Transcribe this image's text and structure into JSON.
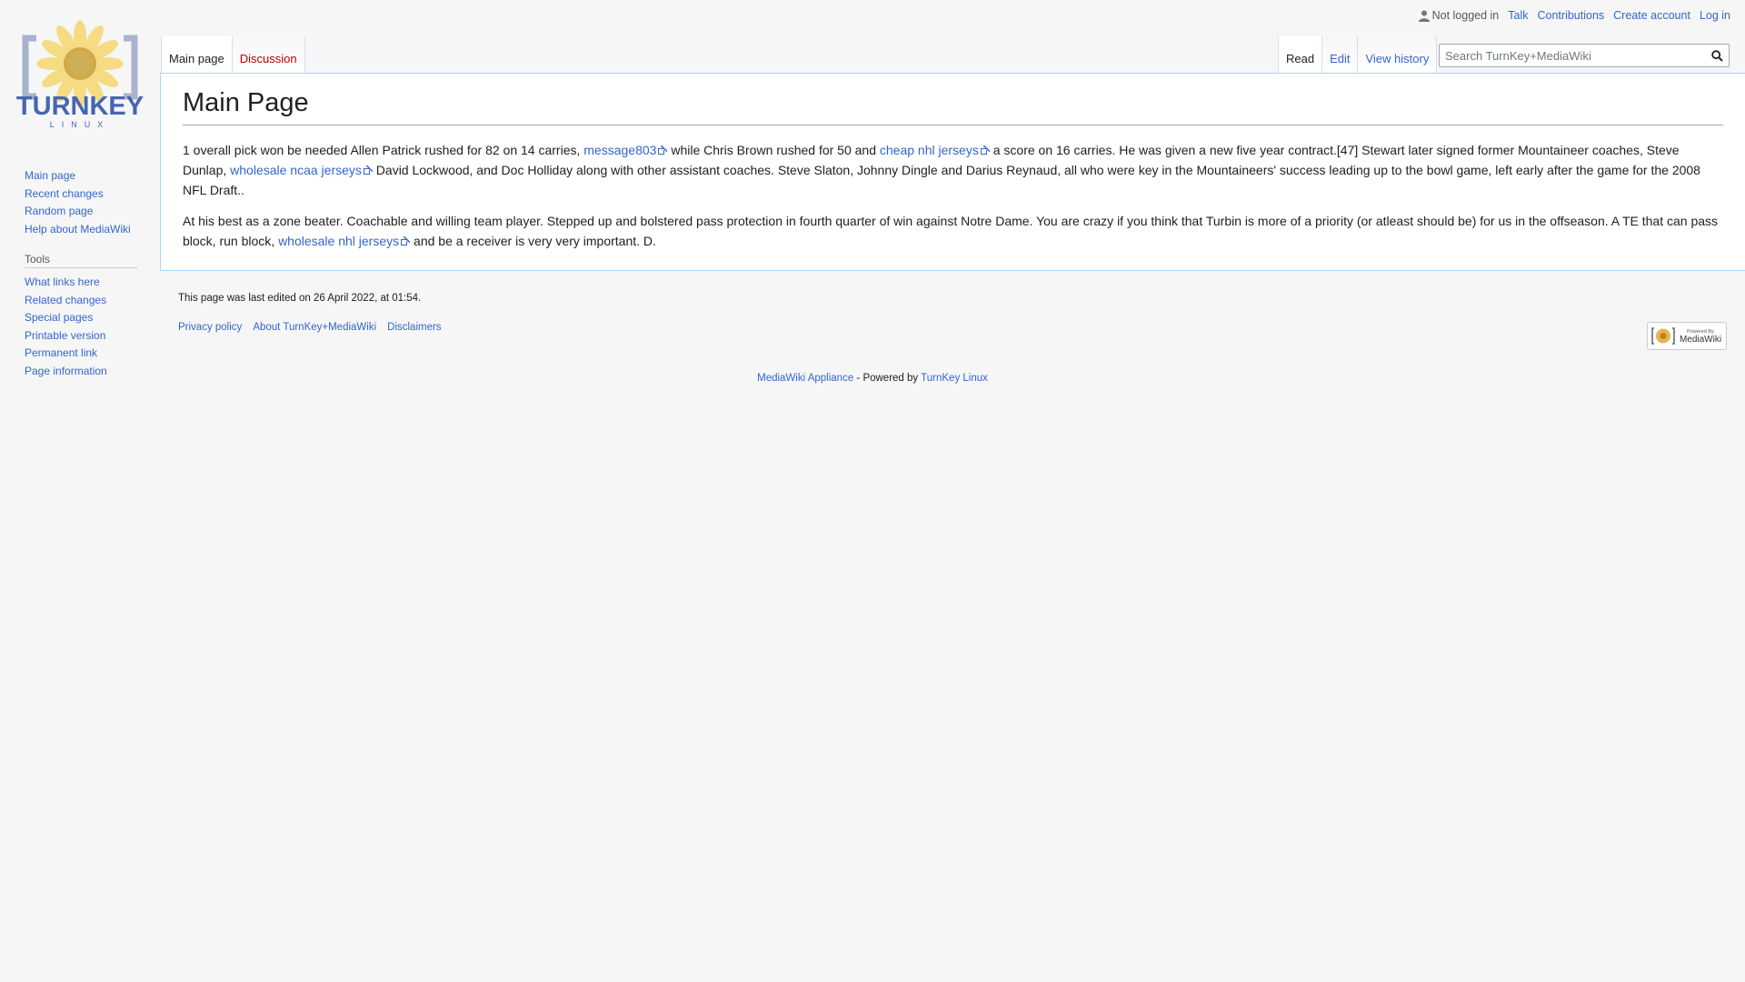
{
  "personal": {
    "status": "Not logged in",
    "talk": "Talk",
    "contributions": "Contributions",
    "create_account": "Create account",
    "log_in": "Log in"
  },
  "tabs_left": {
    "main_page": "Main page",
    "discussion": "Discussion"
  },
  "tabs_right": {
    "read": "Read",
    "edit": "Edit",
    "view_history": "View history"
  },
  "search": {
    "placeholder": "Search TurnKey+MediaWiki"
  },
  "page": {
    "title": "Main Page",
    "p1": {
      "t1": "1 overall pick won be needed Allen Patrick rushed for 82 on 14 carries, ",
      "l1": "message803",
      "t2": " while Chris Brown rushed for 50 and ",
      "l2": "cheap nhl jerseys",
      "t3": " a score on 16 carries. He was given a new five year contract.[47] Stewart later signed former Mountaineer coaches, Steve Dunlap, ",
      "l3": "wholesale ncaa jerseys",
      "t4": " David Lockwood, and Doc Holliday along with other assistant coaches. Steve Slaton, Johnny Dingle and Darius Reynaud, all who were key in the Mountaineers' success leading up to the bowl game, left early after the game for the 2008 NFL Draft.."
    },
    "p2": {
      "t1": "At his best as a zone beater. Coachable and willing team player. Stepped up and bolstered pass protection in fourth quarter of win against Notre Dame. You are crazy if you think that Turbin is more of a priority (or atleast should be) for us in the offseason. A TE that can pass block, run block, ",
      "l1": "wholesale nhl jerseys",
      "t2": " and be a receiver is very very important. D."
    }
  },
  "sidebar": {
    "navigation": [
      "Main page",
      "Recent changes",
      "Random page",
      "Help about MediaWiki"
    ],
    "tools_heading": "Tools",
    "tools": [
      "What links here",
      "Related changes",
      "Special pages",
      "Printable version",
      "Permanent link",
      "Page information"
    ]
  },
  "footer": {
    "last_modified": "This page was last edited on 26 April 2022, at 01:54.",
    "privacy": "Privacy policy",
    "about": "About TurnKey+MediaWiki",
    "disclaimers": "Disclaimers",
    "powered_badge": "Powered By MediaWiki",
    "appliance_link": "MediaWiki Appliance",
    "powered_by_text": " - Powered by ",
    "turnkey_link": "TurnKey Linux"
  },
  "logo_text": "TURNKEY",
  "logo_subtext": "LINUX",
  "colors": {
    "link": "#3366cc",
    "redlink": "#ba0000",
    "border": "#a7d7f9",
    "background": "#f6f6f6"
  }
}
